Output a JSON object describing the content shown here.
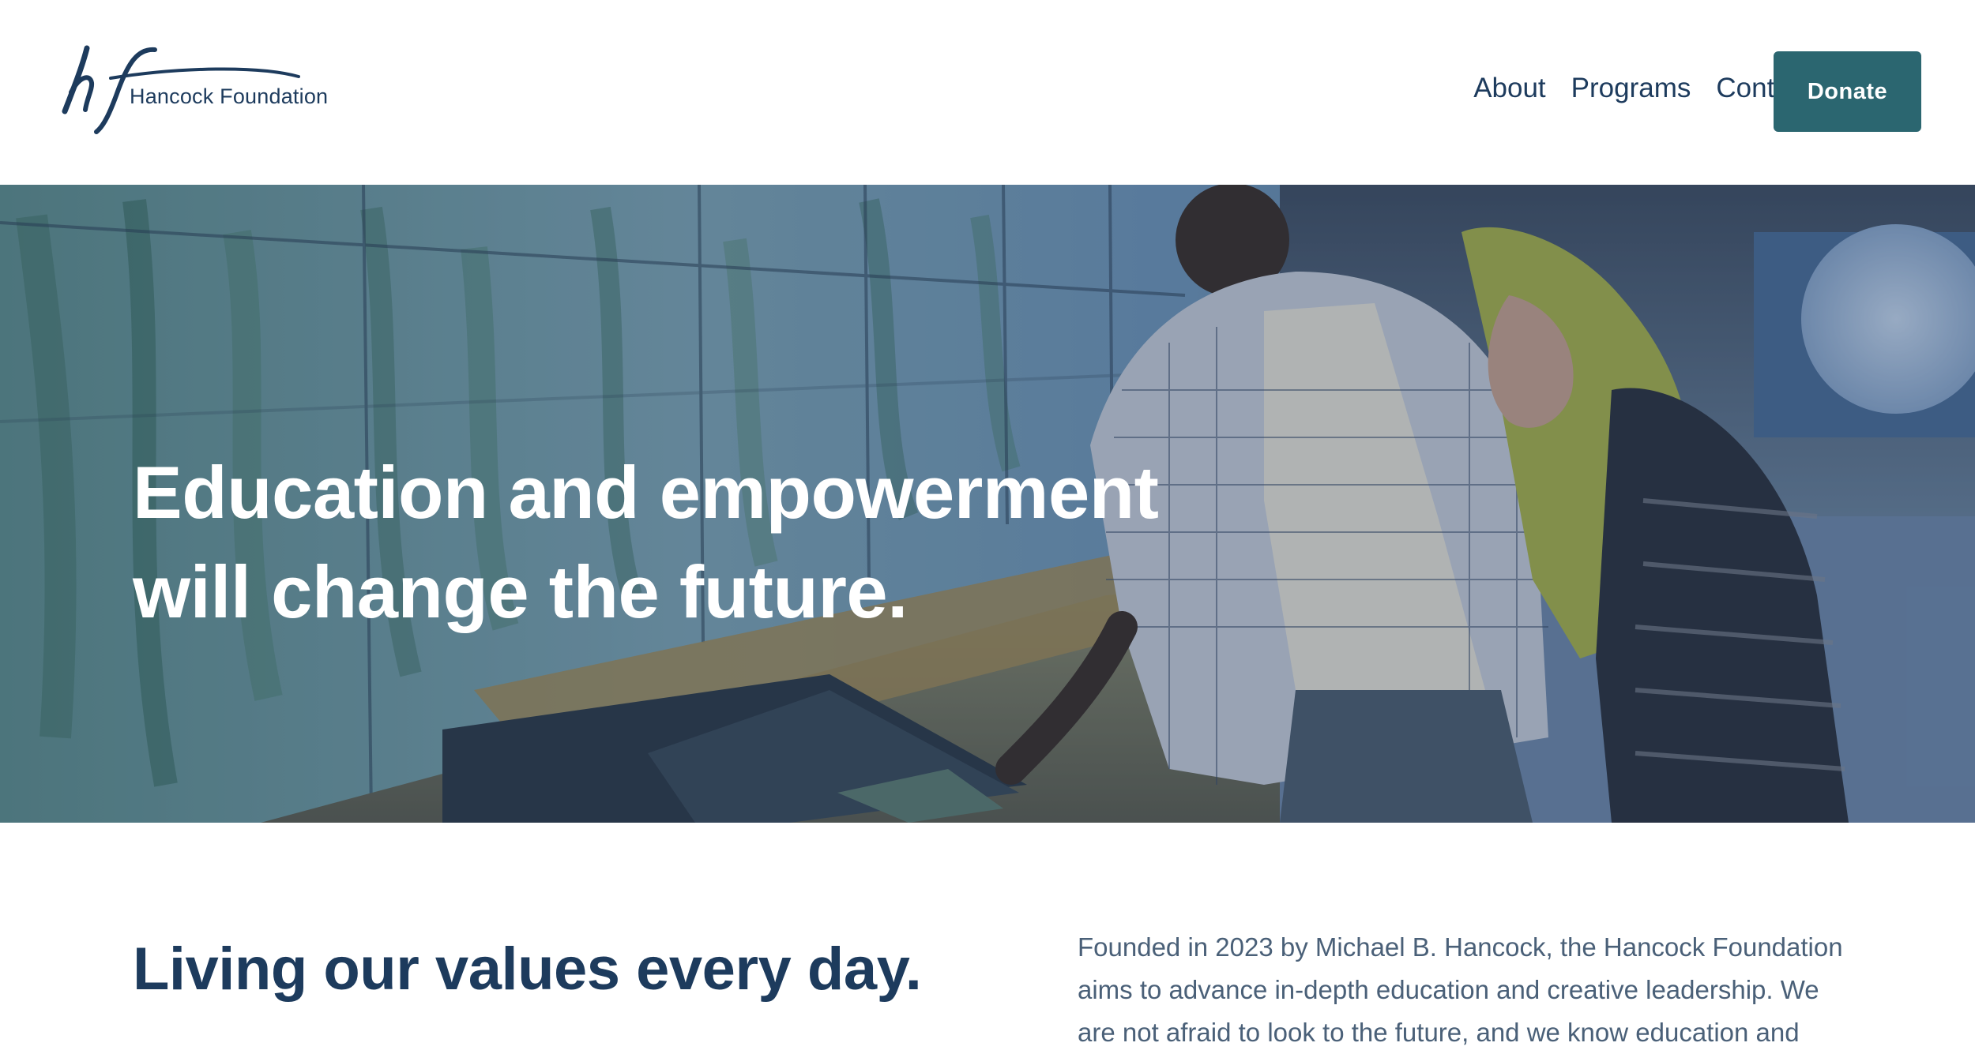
{
  "header": {
    "logo_text": "Hancock Foundation",
    "nav": [
      {
        "label": "About"
      },
      {
        "label": "Programs"
      },
      {
        "label": "Contact"
      }
    ],
    "donate_label": "Donate"
  },
  "hero": {
    "heading_line1": "Education and empowerment",
    "heading_line2": "will change the future."
  },
  "values": {
    "heading": "Living our values every day.",
    "body": "Founded in 2023 by Michael B. Hancock, the Hancock Foundation aims to advance in-depth education and creative leadership. We are not afraid to look to the future, and we know education and"
  },
  "colors": {
    "brand_navy": "#1d3b5d",
    "button_teal": "#2b6670",
    "text_white": "#ffffff",
    "body_gray": "#4a6078"
  },
  "icons": {
    "logo": "hf-monogram-logo"
  }
}
